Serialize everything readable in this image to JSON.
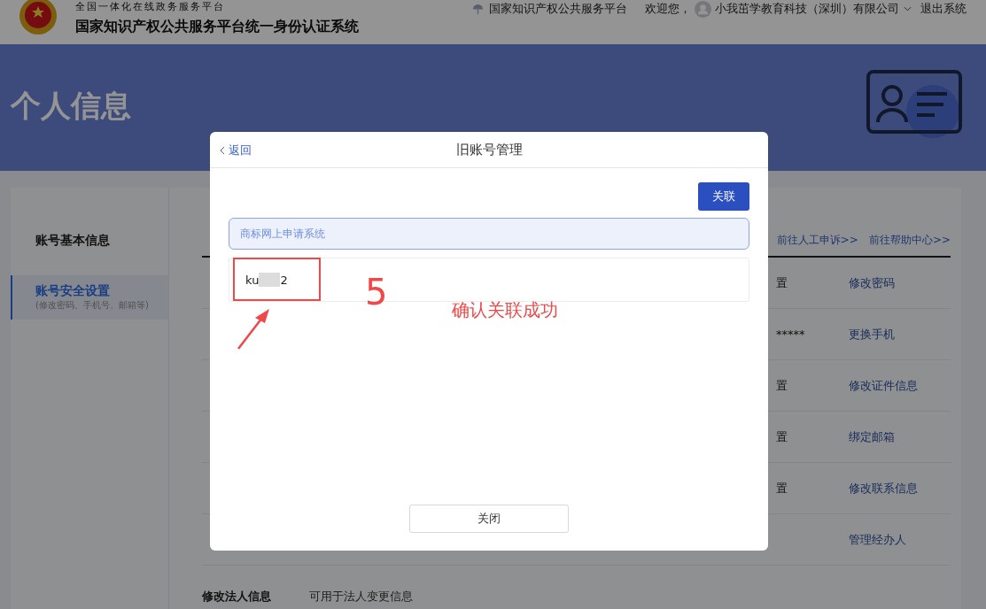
{
  "header": {
    "subtitle": "全国一体化在线政务服务平台",
    "title": "国家知识产权公共服务平台统一身份认证系统",
    "portal_link": "国家知识产权公共服务平台",
    "welcome": "欢迎您，",
    "user": "小我茁学教育科技（深圳）有限公司",
    "logout": "退出系统"
  },
  "banner": {
    "title": "个人信息"
  },
  "sidebar": {
    "items": [
      {
        "label": "账号基本信息",
        "selected": false
      },
      {
        "label": "账号安全设置",
        "hint": "(修改密码、手机号、邮箱等)",
        "selected": true
      }
    ]
  },
  "panel": {
    "links": [
      "前往人工申诉>>",
      "前往帮助中心>>"
    ],
    "rows": [
      {
        "value": "置",
        "action": "修改密码"
      },
      {
        "value": "*****",
        "action": "更换手机"
      },
      {
        "value": "置",
        "action": "修改证件信息"
      },
      {
        "value": "置",
        "action": "绑定邮箱"
      },
      {
        "value": "置",
        "action": "修改联系信息"
      },
      {
        "action": "管理经办人"
      }
    ],
    "footer_row": {
      "label": "修改法人信息",
      "description": "可用于法人变更信息"
    }
  },
  "dialog": {
    "back": "返回",
    "title": "旧账号管理",
    "link_button": "关联",
    "system": "商标网上申请系统",
    "account": {
      "prefix": "ku",
      "suffix": "2"
    },
    "close_button": "关闭"
  },
  "annotation": {
    "step": "5",
    "note": "确认关联成功"
  }
}
